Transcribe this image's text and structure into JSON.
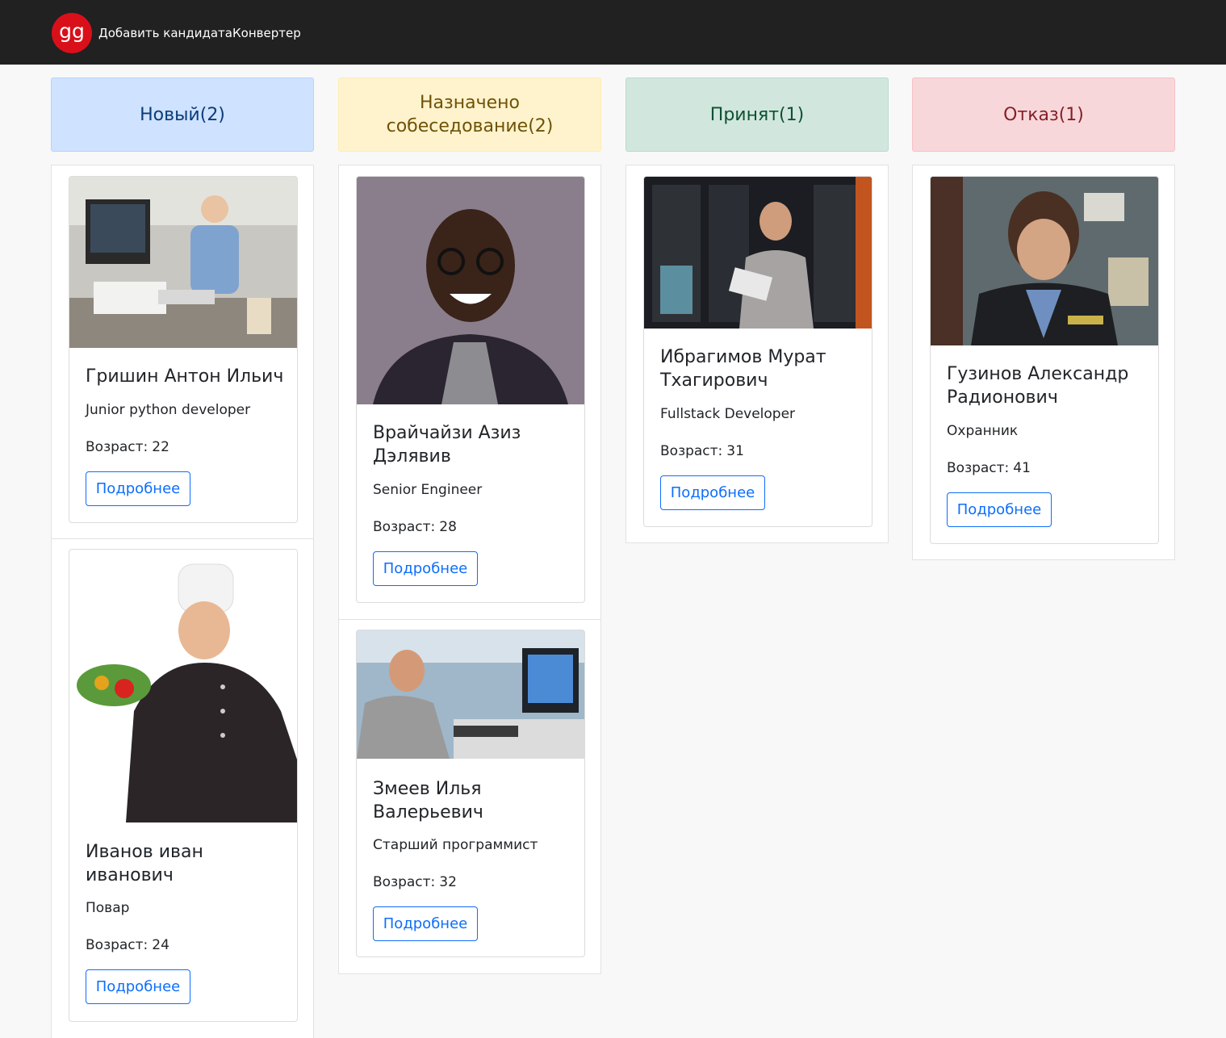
{
  "navbar": {
    "logo_text": "gg",
    "links": [
      "Добавить кандидата",
      "Конвертер"
    ]
  },
  "columns": [
    {
      "title": "Новый(2)",
      "bg": "#cfe2ff",
      "color": "#0a3d7a",
      "border": "#b6d4fe"
    },
    {
      "title": "Назначено собеседование(2)",
      "bg": "#fff3cd",
      "color": "#6f5207",
      "border": "#ffecb5"
    },
    {
      "title": "Принят(1)",
      "bg": "#d1e7dd",
      "color": "#0f5132",
      "border": "#badbcc"
    },
    {
      "title": "Отказ(1)",
      "bg": "#f8d7da",
      "color": "#842029",
      "border": "#f5c2c7"
    }
  ],
  "candidates": [
    {
      "name": "Гришин Антон Ильич",
      "position": "Junior python developer",
      "age_label": "Возраст:",
      "age": "22",
      "button": "Подробнее",
      "photo": "person-at-desk-headphones"
    },
    {
      "name": "Иванов иван иванович",
      "position": "Повар",
      "age_label": "Возраст:",
      "age": "24",
      "button": "Подробнее",
      "photo": "chef-with-vegetables"
    },
    {
      "name": "Врайчайзи Азиз Дэлявив",
      "position": "Senior Engineer",
      "age_label": "Возраст:",
      "age": "28",
      "button": "Подробнее",
      "photo": "smiling-man-glasses"
    },
    {
      "name": "Змеев Илья Валерьевич",
      "position": "Старший программист",
      "age_label": "Возраст:",
      "age": "32",
      "button": "Подробнее",
      "photo": "man-at-computer"
    },
    {
      "name": "Ибрагимов Мурат Тхагирович",
      "position": "Fullstack Developer",
      "age_label": "Возраст:",
      "age": "31",
      "button": "Подробнее",
      "photo": "man-server-room-tablet"
    },
    {
      "name": "Гузинов Александр Радионович",
      "position": "Охранник",
      "age_label": "Возраст:",
      "age": "41",
      "button": "Подробнее",
      "photo": "security-guard"
    }
  ]
}
